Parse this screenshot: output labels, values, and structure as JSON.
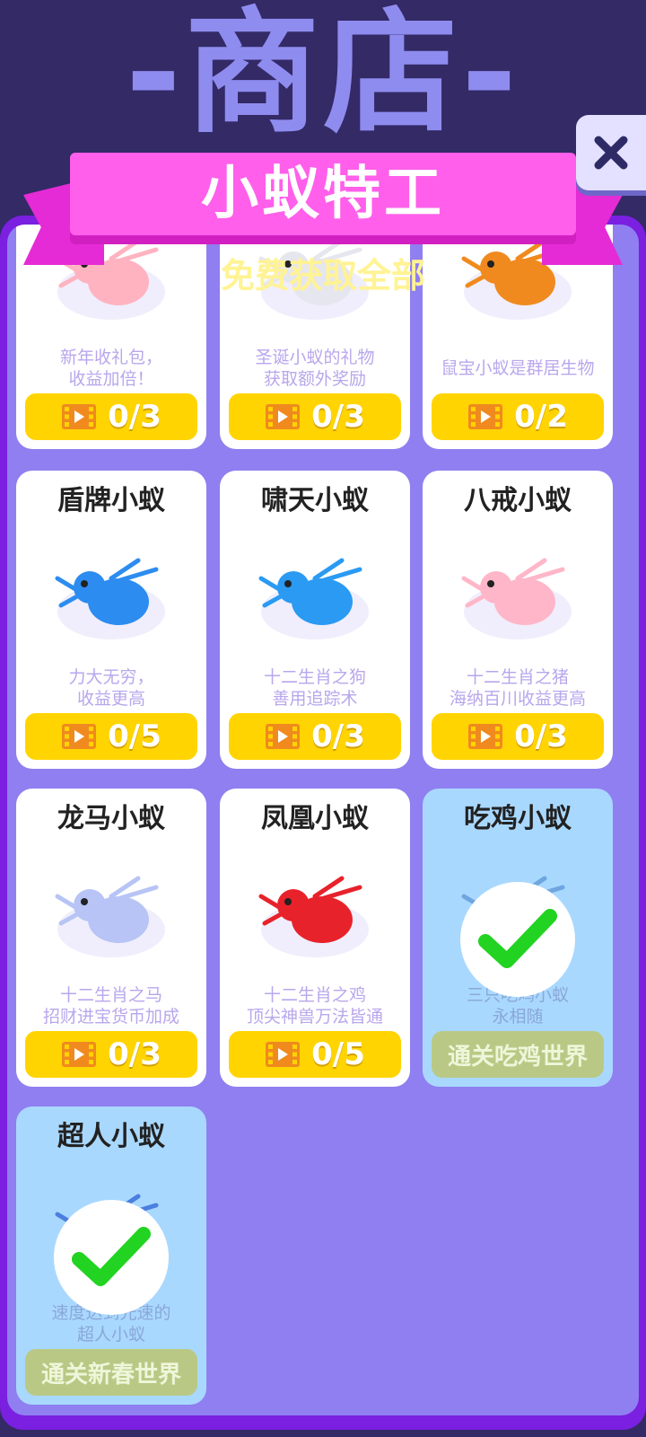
{
  "header": {
    "shop_title": "-商店-",
    "close_icon": "close-icon",
    "ribbon_title": "小蚁特工",
    "subtitle": "免费获取全部"
  },
  "colors": {
    "accent_pink": "#ff5fea",
    "button_yellow": "#ffd400",
    "owned_card": "#a9d8ff",
    "check_green": "#22d322"
  },
  "cards": [
    {
      "name": "",
      "desc1": "新年收礼包，",
      "desc2": "收益加倍！",
      "button": "0/3",
      "owned": false,
      "pet": "pig-icon"
    },
    {
      "name": "",
      "desc1": "圣诞小蚁的礼物",
      "desc2": "获取额外奖励",
      "button": "0/3",
      "owned": false,
      "pet": "gift-icon"
    },
    {
      "name": "",
      "desc1": "鼠宝小蚁是群居生物",
      "desc2": "",
      "button": "0/2",
      "owned": false,
      "pet": "rat-icon"
    },
    {
      "name": "盾牌小蚁",
      "desc1": "力大无穷，",
      "desc2": "收益更高",
      "button": "0/5",
      "owned": false,
      "pet": "shield-ant-icon"
    },
    {
      "name": "啸天小蚁",
      "desc1": "十二生肖之狗",
      "desc2": "善用追踪术",
      "button": "0/3",
      "owned": false,
      "pet": "dog-ant-icon"
    },
    {
      "name": "八戒小蚁",
      "desc1": "十二生肖之猪",
      "desc2": "海纳百川收益更高",
      "button": "0/3",
      "owned": false,
      "pet": "pig-ant-icon"
    },
    {
      "name": "龙马小蚁",
      "desc1": "十二生肖之马",
      "desc2": "招财进宝货币加成",
      "button": "0/3",
      "owned": false,
      "pet": "horse-ant-icon"
    },
    {
      "name": "凤凰小蚁",
      "desc1": "十二生肖之鸡",
      "desc2": "顶尖神兽万法皆通",
      "button": "0/5",
      "owned": false,
      "pet": "phoenix-ant-icon"
    },
    {
      "name": "吃鸡小蚁",
      "desc1": "三只吃鸡小蚁",
      "desc2": "永相随",
      "button": "通关吃鸡世界",
      "owned": true,
      "pet": "chicken-ant-icon"
    },
    {
      "name": "超人小蚁",
      "desc1": "速度达到光速的",
      "desc2": "超人小蚁",
      "button": "通关新春世界",
      "owned": true,
      "pet": "superman-ant-icon"
    }
  ]
}
